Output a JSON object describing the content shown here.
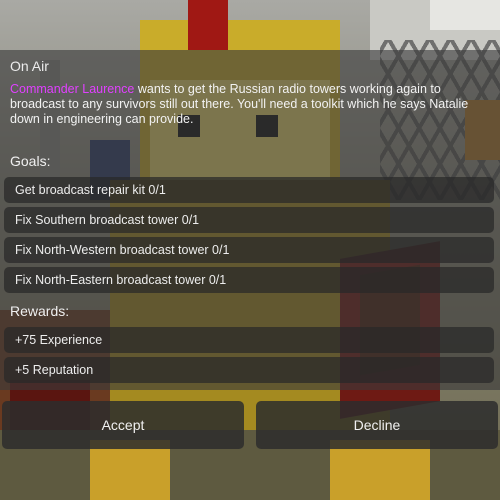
{
  "quest": {
    "title": "On Air",
    "npc_name": "Commander Laurence",
    "description": " wants to get the Russian radio towers working again to broadcast to any survivors still out there. You'll need a toolkit which he says Natalie down in engineering can provide.",
    "goals_label": "Goals:",
    "goals": [
      "Get broadcast repair kit 0/1",
      "Fix Southern broadcast tower 0/1",
      "Fix North-Western broadcast tower 0/1",
      "Fix North-Eastern broadcast tower 0/1"
    ],
    "rewards_label": "Rewards:",
    "rewards": [
      "+75 Experience",
      "+5 Reputation"
    ]
  },
  "actions": {
    "accept_label": "Accept",
    "decline_label": "Decline"
  },
  "colors": {
    "npc_name": "#e040ff",
    "dialog_bg": "rgba(58,58,58,0.62)",
    "row_bg": "rgba(40,40,40,0.72)"
  }
}
